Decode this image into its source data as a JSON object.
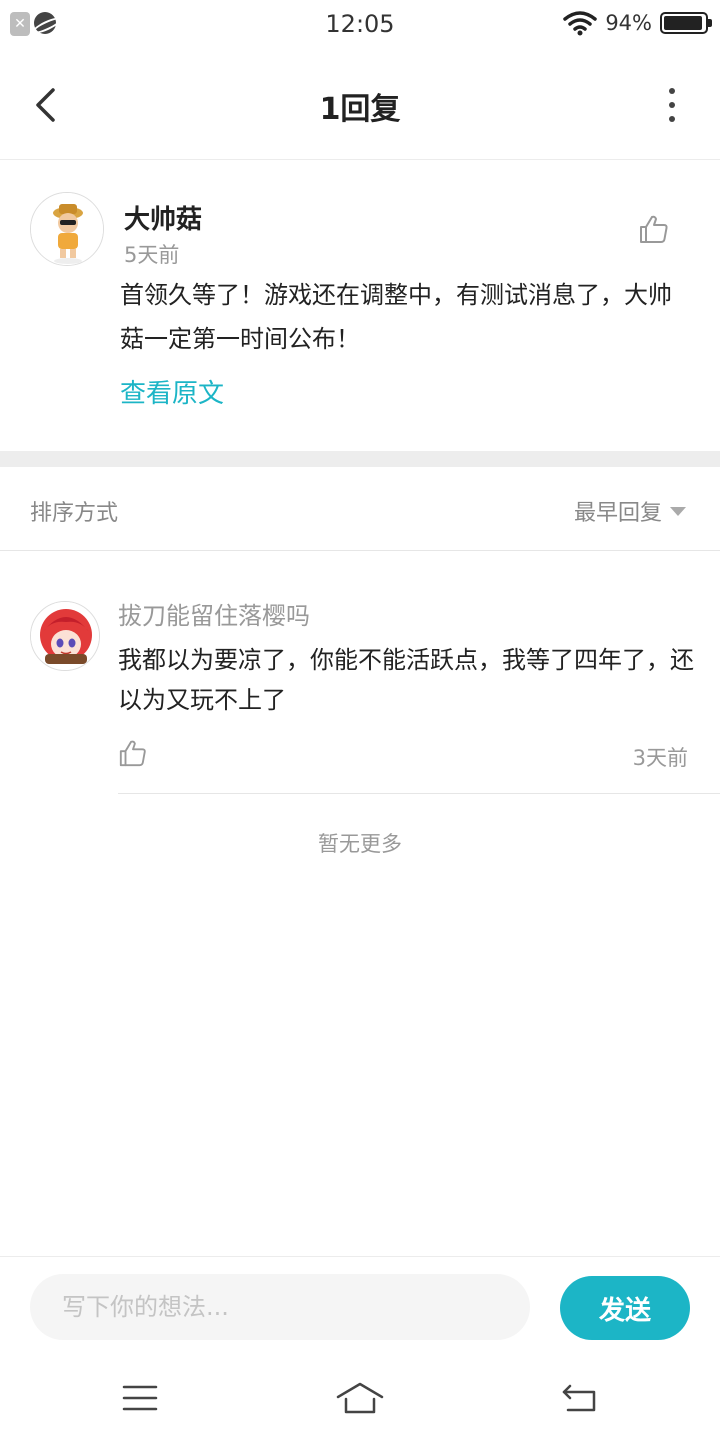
{
  "status_bar": {
    "time": "12:05",
    "battery_percent": "94%",
    "battery_level": 0.94,
    "icons": [
      "app-notification-icon",
      "planet-icon",
      "wifi-icon",
      "battery-icon"
    ]
  },
  "header": {
    "title": "1回复",
    "icons": [
      "back-arrow-icon",
      "more-vertical-icon"
    ]
  },
  "post": {
    "author": "大帅菇",
    "time": "5天前",
    "text": "首领久等了！游戏还在调整中，有测试消息了，大帅菇一定第一时间公布！",
    "view_original": "查看原文",
    "icons": [
      "avatar",
      "thumbs-up-icon"
    ]
  },
  "sort": {
    "label": "排序方式",
    "value": "最早回复",
    "icon": "caret-down-icon"
  },
  "replies": [
    {
      "author": "拔刀能留住落樱吗",
      "text": "我都以为要凉了，你能不能活跃点，我等了四年了，还以为又玩不上了",
      "time": "3天前"
    }
  ],
  "no_more": "暂无更多",
  "composer": {
    "placeholder": "写下你的想法...",
    "send_label": "发送"
  },
  "colors": {
    "accent": "#1cb5c6",
    "divider": "#ededed",
    "muted_text": "#999999"
  },
  "nav_bar": {
    "icons": [
      "menu-icon",
      "home-icon",
      "back-icon"
    ]
  }
}
